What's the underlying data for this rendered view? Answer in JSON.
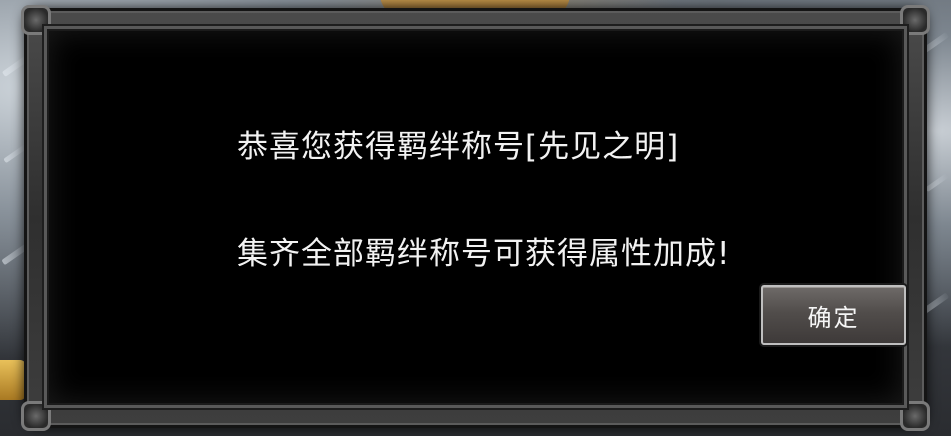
{
  "dialog": {
    "message_line_1": "恭喜您获得羁绊称号[先见之明]",
    "message_line_2": "集齐全部羁绊称号可获得属性加成!",
    "confirm_label": "确定"
  },
  "colors": {
    "panel_background": "#000000",
    "frame": "#3e3e3e",
    "text": "#f2f2f2",
    "button": "#514d4b"
  }
}
